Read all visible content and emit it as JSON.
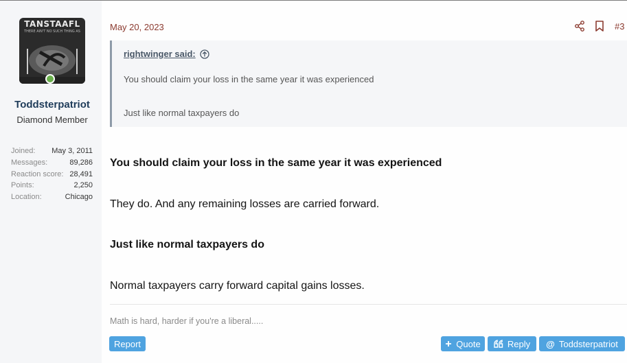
{
  "user": {
    "avatar_title": "TANSTAAFL",
    "avatar_subtitle": "THERE AIN'T NO SUCH THING AS",
    "name": "Toddsterpatriot",
    "title": "Diamond Member",
    "stats": [
      {
        "label": "Joined:",
        "value": "May 3, 2011"
      },
      {
        "label": "Messages:",
        "value": "89,286"
      },
      {
        "label": "Reaction score:",
        "value": "28,491"
      },
      {
        "label": "Points:",
        "value": "2,250"
      },
      {
        "label": "Location:",
        "value": "Chicago"
      }
    ]
  },
  "post": {
    "date": "May 20, 2023",
    "number": "#3",
    "quote": {
      "author": "rightwinger said:",
      "lines": [
        "You should claim your loss in the same year it was experienced",
        "Just like normal taxpayers do"
      ]
    },
    "body": [
      "You should claim your loss in the same year it was experienced",
      "They do. And any remaining losses are carried forward.",
      "Just like normal taxpayers do",
      "Normal taxpayers carry forward capital gains losses."
    ],
    "signature": "Math is hard, harder if you're a liberal....."
  },
  "actions": {
    "report": "Report",
    "quote": "Quote",
    "reply": "Reply",
    "mention": "Toddsterpatriot"
  },
  "colors": {
    "accent_blue": "#4fa3e0",
    "date_red": "#8b3a2f",
    "username_navy": "#1f3c5a"
  }
}
